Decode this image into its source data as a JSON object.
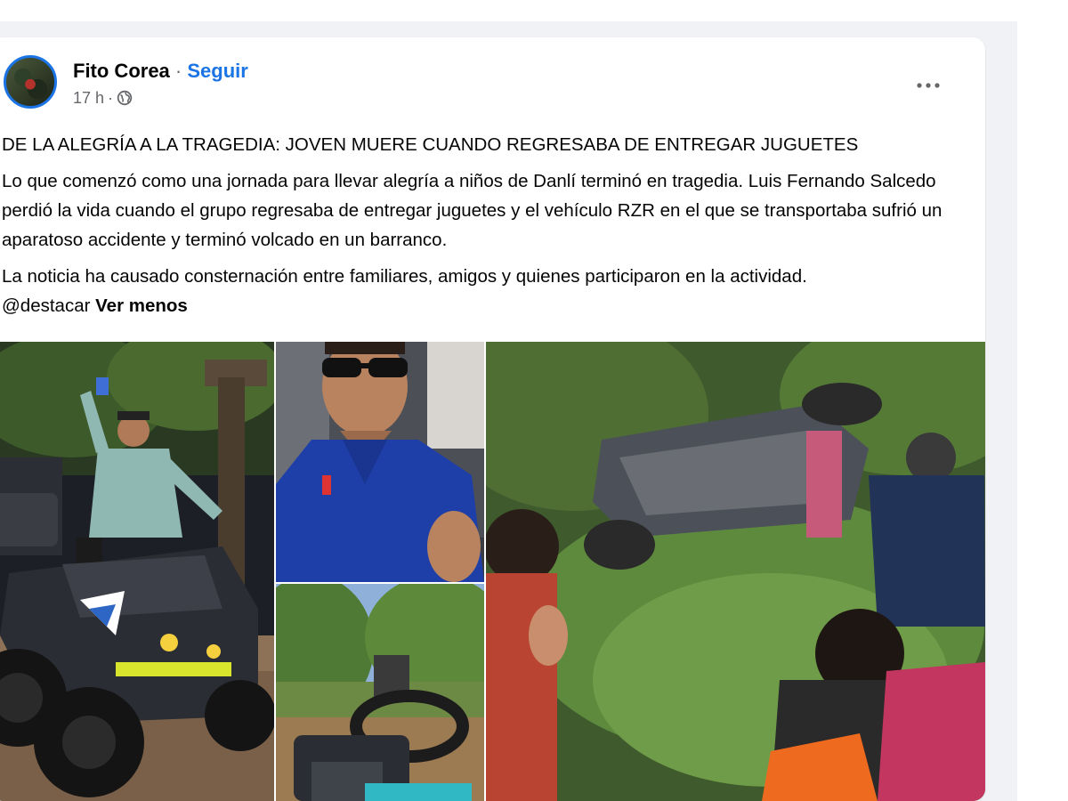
{
  "post": {
    "author": "Fito Corea",
    "separator": "·",
    "follow_label": "Seguir",
    "time": "17 h",
    "time_separator": "·",
    "privacy_icon": "globe-icon",
    "more_icon": "more-horizontal-icon",
    "headline": "DE LA ALEGRÍA A LA TRAGEDIA: JOVEN MUERE CUANDO REGRESABA DE ENTREGAR JUGUETES",
    "paragraph_1": "Lo que comenzó como una jornada para llevar alegría a niños de Danlí terminó en tragedia. Luis Fernando Salcedo perdió la vida cuando el grupo regresaba de entregar juguetes y el vehículo RZR en el que se transportaba sufrió un aparatoso accidente y terminó volcado en un barranco.",
    "paragraph_2": "La noticia ha causado consternación entre familiares, amigos y quienes participaron en la actividad.",
    "mention": "@destacar",
    "see_less_label": "Ver menos"
  },
  "colors": {
    "link_blue": "#1b74e4",
    "text_primary": "#050505",
    "text_secondary": "#65676b",
    "feed_background": "#f0f2f5"
  }
}
